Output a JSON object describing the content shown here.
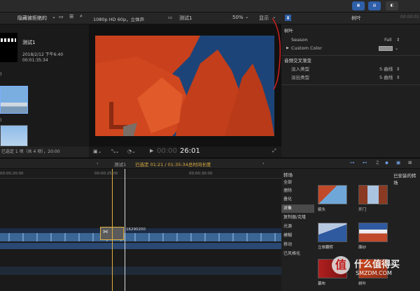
{
  "libbar": {
    "title": "隐藏被拒绝的"
  },
  "library": {
    "event_title": "测试1",
    "event_date": "2018/2/12 下午6:40",
    "event_duration": "00:01:35:34",
    "footer": "已选定 1 项（共 4 项），20:00"
  },
  "viewer": {
    "format": "1080p HD 60p，立体声",
    "title": "测试1",
    "zoom": "50%",
    "display_menu": "显示"
  },
  "controls": {
    "timecode_prefix": "00:00",
    "timecode": "26:01"
  },
  "inspector": {
    "tab_title": "树叶",
    "timecode": "00:00:01",
    "section_title": "树叶",
    "season_label": "Season",
    "season_value": "Fall",
    "custom_color_label": "Custom Color",
    "crossfade_title": "音频交叉渐变",
    "fade_in_label": "淡入类型",
    "fade_in_value": "S 曲线",
    "fade_out_label": "淡出类型",
    "fade_out_value": "S 曲线"
  },
  "timeline": {
    "project": "测试1",
    "selection": "已选定 01:21 / 01:35:34总时间长度",
    "ruler": [
      "00:00:20:00",
      "00:00:25:00",
      "00:00:30:00"
    ],
    "clip_label": "16290200"
  },
  "browser": {
    "tab": "转场",
    "installed": "已安装的转场",
    "categories": [
      "全部",
      "擦除",
      "叠化",
      "对象",
      "复制器/克隆",
      "光源",
      "模糊",
      "移动",
      "已风格化"
    ],
    "selected_category": 3,
    "effects": [
      "箭头",
      "开门",
      "立体翻转",
      "面纱",
      "幕布",
      "树叶"
    ]
  },
  "watermark": {
    "line1": "什么值得买",
    "line2": "SMZDM.COM"
  },
  "colors": {
    "accent": "#2f5fa8",
    "highlight": "#e0b040",
    "annotation": "#d22020"
  }
}
